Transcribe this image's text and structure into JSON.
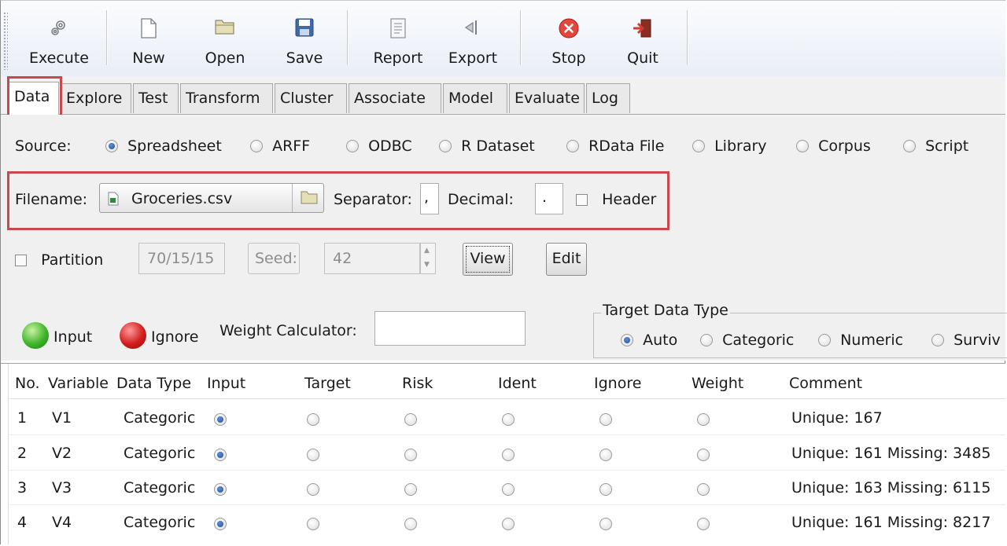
{
  "toolbar": {
    "items": [
      {
        "label": "Execute",
        "icon": "gear-icon"
      },
      {
        "label": "New",
        "icon": "new-document-icon"
      },
      {
        "label": "Open",
        "icon": "folder-icon"
      },
      {
        "label": "Save",
        "icon": "floppy-disk-icon"
      },
      {
        "label": "Report",
        "icon": "report-icon"
      },
      {
        "label": "Export",
        "icon": "export-icon"
      },
      {
        "label": "Stop",
        "icon": "stop-icon"
      },
      {
        "label": "Quit",
        "icon": "quit-door-icon"
      }
    ]
  },
  "tabs": [
    "Data",
    "Explore",
    "Test",
    "Transform",
    "Cluster",
    "Associate",
    "Model",
    "Evaluate",
    "Log"
  ],
  "source": {
    "label": "Source:",
    "options": [
      "Spreadsheet",
      "ARFF",
      "ODBC",
      "R Dataset",
      "RData File",
      "Library",
      "Corpus",
      "Script"
    ],
    "selected": "Spreadsheet"
  },
  "file": {
    "filename_label": "Filename:",
    "filename_value": "Groceries.csv",
    "separator_label": "Separator:",
    "separator_value": ",",
    "decimal_label": "Decimal:",
    "decimal_value": ".",
    "header_label": "Header",
    "header_checked": false
  },
  "partition": {
    "label": "Partition",
    "checked": false,
    "value": "70/15/15",
    "seed_label": "Seed:",
    "seed_value": "42",
    "view_label": "View",
    "edit_label": "Edit"
  },
  "roles": {
    "input_label": "Input",
    "ignore_label": "Ignore",
    "weight_label": "Weight Calculator:",
    "weight_value": "",
    "colors": {
      "input": "#3fb52a",
      "ignore": "#d21d1d"
    }
  },
  "target_type": {
    "title": "Target Data Type",
    "options": [
      "Auto",
      "Categoric",
      "Numeric",
      "Surviv"
    ],
    "selected": "Auto"
  },
  "table": {
    "headers": [
      "No.",
      "Variable",
      "Data Type",
      "Input",
      "Target",
      "Risk",
      "Ident",
      "Ignore",
      "Weight",
      "Comment"
    ],
    "rows": [
      {
        "no": "1",
        "variable": "V1",
        "type": "Categoric",
        "role": "Input",
        "comment": "Unique: 167"
      },
      {
        "no": "2",
        "variable": "V2",
        "type": "Categoric",
        "role": "Input",
        "comment": "Unique: 161 Missing: 3485"
      },
      {
        "no": "3",
        "variable": "V3",
        "type": "Categoric",
        "role": "Input",
        "comment": "Unique: 163 Missing: 6115"
      },
      {
        "no": "4",
        "variable": "V4",
        "type": "Categoric",
        "role": "Input",
        "comment": "Unique: 161 Missing: 8217"
      }
    ]
  },
  "accent_color": "#c8484f"
}
